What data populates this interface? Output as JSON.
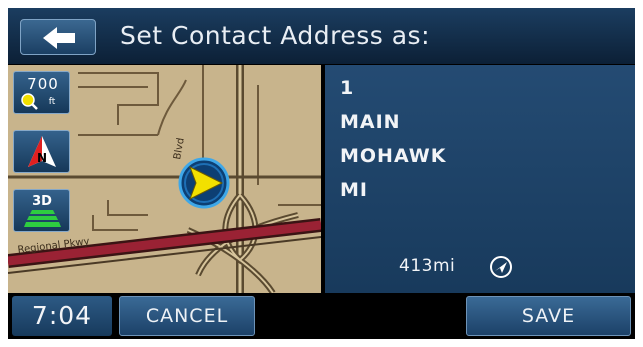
{
  "header": {
    "back_icon": "back-arrow-icon",
    "title": "Set Contact Address as:"
  },
  "map": {
    "zoom_value": "700",
    "zoom_unit": "ft",
    "zoom_icon": "magnifier-icon",
    "north_icon": "north-compass-icon",
    "north_label": "N",
    "view_label": "3D",
    "street_label": "Blvd",
    "road_label": "Regional Pkwy",
    "vehicle_icon": "vehicle-position-arrow-icon"
  },
  "address": {
    "number": "1",
    "street": "MAIN",
    "city": "MOHAWK",
    "state": "MI",
    "distance": "413mi",
    "direction_icon": "direction-arrow-icon"
  },
  "bottom": {
    "time": "7:04",
    "cancel_label": "CANCEL",
    "save_label": "SAVE"
  },
  "colors": {
    "header_bg": "#12304d",
    "panel_bg": "#1f4469",
    "button_bg": "#2b5883",
    "map_land": "#c8b48c",
    "map_road_major": "#8b1d2c",
    "vehicle_fill": "#f2e000"
  }
}
